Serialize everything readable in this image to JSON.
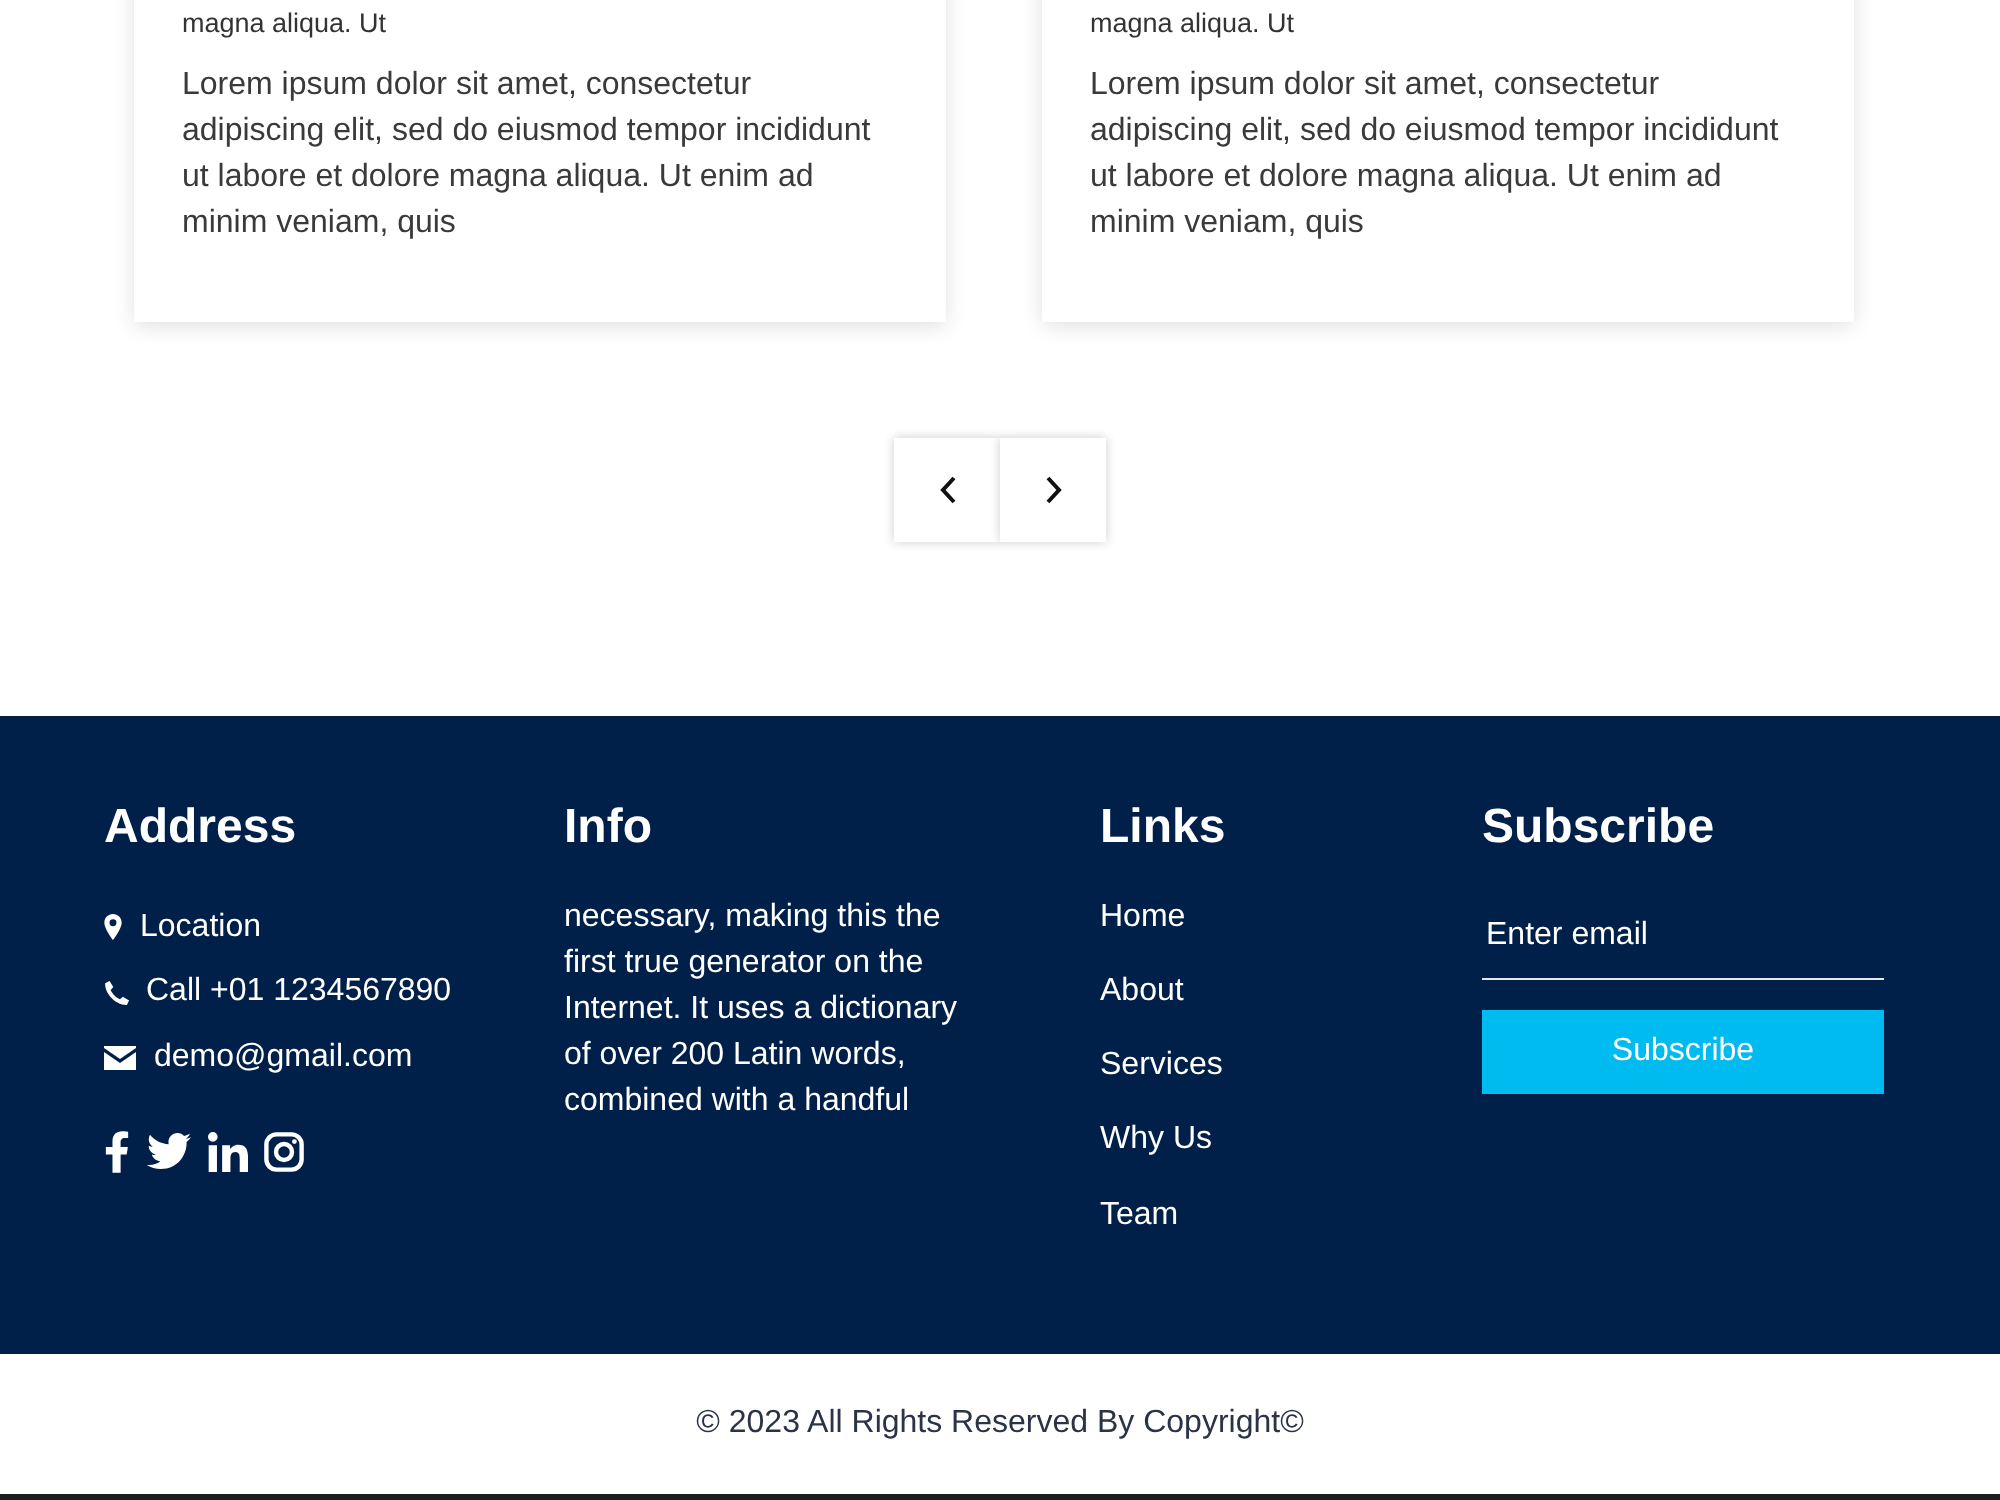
{
  "cards": [
    {
      "subtitle": "magna aliqua. Ut",
      "text": "Lorem ipsum dolor sit amet, consectetur adipiscing elit, sed do eiusmod tempor incididunt ut labore et dolore magna aliqua. Ut enim ad minim veniam, quis"
    },
    {
      "subtitle": "magna aliqua. Ut",
      "text": "Lorem ipsum dolor sit amet, consectetur adipiscing elit, sed do eiusmod tempor incididunt ut labore et dolore magna aliqua. Ut enim ad minim veniam, quis"
    }
  ],
  "carousel_controls": [
    {
      "kind": "previous"
    },
    {
      "kind": "next"
    }
  ],
  "footer": {
    "address": {
      "heading": "Address",
      "items": [
        {
          "kind": "location",
          "text": "Location"
        },
        {
          "kind": "phone",
          "text": "Call +01 1234567890"
        },
        {
          "kind": "email",
          "text": "demo@gmail.com"
        }
      ],
      "social": [
        {
          "kind": "facebook"
        },
        {
          "kind": "twitter"
        },
        {
          "kind": "linkedin"
        },
        {
          "kind": "instagram"
        }
      ]
    },
    "info": {
      "heading": "Info",
      "text": "necessary, making this the first true generator on the Internet. It uses a dictionary of over 200 Latin words, combined with a handful"
    },
    "links": {
      "heading": "Links",
      "items": [
        "Home",
        "About",
        "Services",
        "Why Us",
        "Team"
      ]
    },
    "subscribe": {
      "heading": "Subscribe",
      "placeholder": "Enter email",
      "button": "Subscribe"
    }
  },
  "copyright": "© 2023 All Rights Reserved By Copyright©"
}
